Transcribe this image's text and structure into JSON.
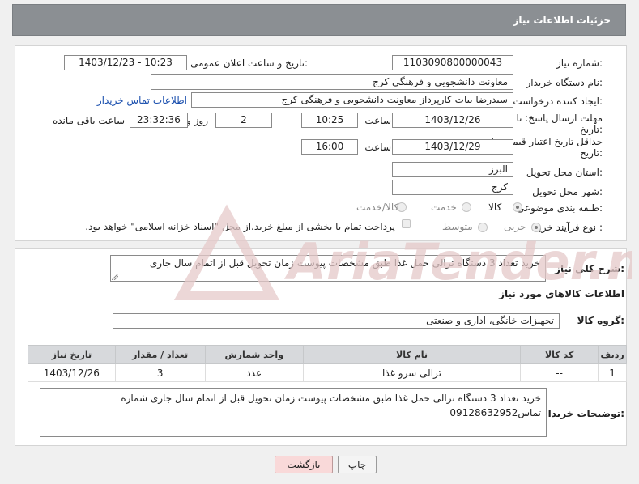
{
  "header": {
    "title": "جزئیات اطلاعات نیاز"
  },
  "fields": {
    "need_number_label": "شماره نیاز:",
    "need_number": "1103090800000043",
    "announce_label": "تاریخ و ساعت اعلان عمومی:",
    "announce_value": "1403/12/23 - 10:23",
    "buyer_org_label": "نام دستگاه خریدار:",
    "buyer_org": "معاونت دانشجویی و فرهنگی کرج",
    "creator_label": "ایجاد کننده درخواست:",
    "creator": "سیدرضا بیات کارپرداز معاونت دانشجویی و فرهنگی کرج",
    "contact_link": "اطلاعات تماس خریدار",
    "deadline_label_1": "مهلت ارسال پاسخ: تا",
    "deadline_label_2": "تاریخ:",
    "deadline_date": "1403/12/26",
    "time_label": "ساعت",
    "deadline_time": "10:25",
    "days_value": "2",
    "days_label": "روز و",
    "remaining_value": "23:32:36",
    "remaining_label": "ساعت باقی مانده",
    "validity_label_1": "حداقل تاریخ اعتبار قیمت: تا",
    "validity_label_2": "تاریخ:",
    "validity_date": "1403/12/29",
    "validity_time": "16:00",
    "province_label": "استان محل تحویل:",
    "province": "البرز",
    "city_label": "شهر محل تحویل:",
    "city": "کرج",
    "category_label": "طبقه بندی موضوعی:",
    "category_options": [
      "کالا",
      "خدمت",
      "کالا/خدمت"
    ],
    "process_label": "نوع فرآیند خرید :",
    "process_options": [
      "جزیی",
      "متوسط"
    ],
    "payment_text": "پرداخت تمام یا بخشی از مبلغ خرید،از محل \"اسناد خزانه اسلامی\" خواهد بود."
  },
  "details": {
    "desc_label": "شرح کلی نیاز:",
    "desc_value": "خرید تعداد 3 دستگاه ترالی حمل غذا طبق مشخصات پیوست زمان تحویل قبل از اتمام سال جاری",
    "goods_info_title": "اطلاعات کالاهای مورد نیاز",
    "goods_group_label": "گروه کالا:",
    "goods_group_value": "تجهیزات خانگی، اداری و صنعتی"
  },
  "table": {
    "headers": [
      "ردیف",
      "کد کالا",
      "نام کالا",
      "واحد شمارش",
      "تعداد / مقدار",
      "تاریخ نیاز"
    ],
    "rows": [
      [
        "1",
        "--",
        "ترالی سرو غذا",
        "عدد",
        "3",
        "1403/12/26"
      ]
    ]
  },
  "buyer_notes": {
    "label": "توضیحات خریدار:",
    "value": "خرید تعداد 3 دستگاه ترالی حمل غذا طبق مشخصات پیوست زمان تحویل قبل از اتمام سال جاری شماره تماس09128632952"
  },
  "buttons": {
    "print": "چاپ",
    "back": "بازگشت"
  },
  "colors": {
    "header_bg": "#8b8f93",
    "link": "#1a4fae",
    "back_button_bg": "#f9d9d9",
    "watermark": "#e5c9c9"
  },
  "watermark_text": "AriaTender.neT"
}
